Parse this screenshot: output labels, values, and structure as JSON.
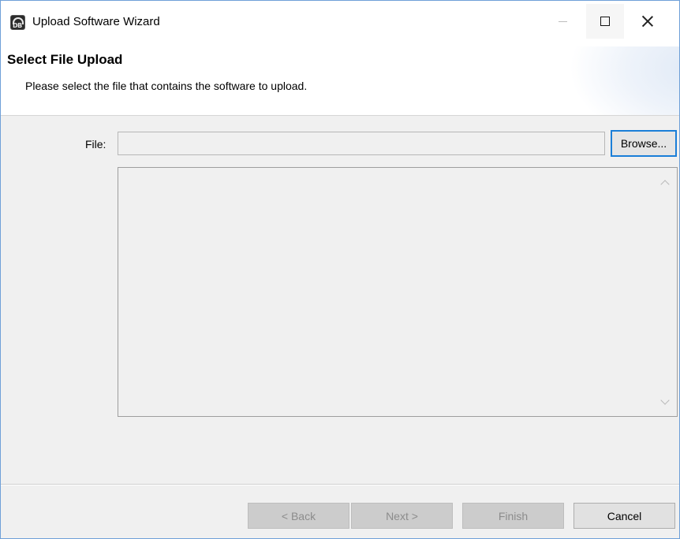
{
  "window": {
    "title": "Upload Software Wizard",
    "app_icon": "db-app-icon",
    "controls": [
      "minimize-icon",
      "maximize-icon",
      "close-icon"
    ]
  },
  "header": {
    "title": "Select File Upload",
    "description": "Please select the file that contains the software to upload."
  },
  "form": {
    "file_label": "File:",
    "file_value": "",
    "browse_label": "Browse..."
  },
  "buttons": {
    "back": {
      "label": "< Back",
      "enabled": false
    },
    "next": {
      "label": "Next >",
      "enabled": false
    },
    "finish": {
      "label": "Finish",
      "enabled": false
    },
    "cancel": {
      "label": "Cancel",
      "enabled": true
    }
  },
  "colors": {
    "accent": "#1a7ed8",
    "window_border": "#6fa0d8",
    "background": "#f0f0f0"
  }
}
